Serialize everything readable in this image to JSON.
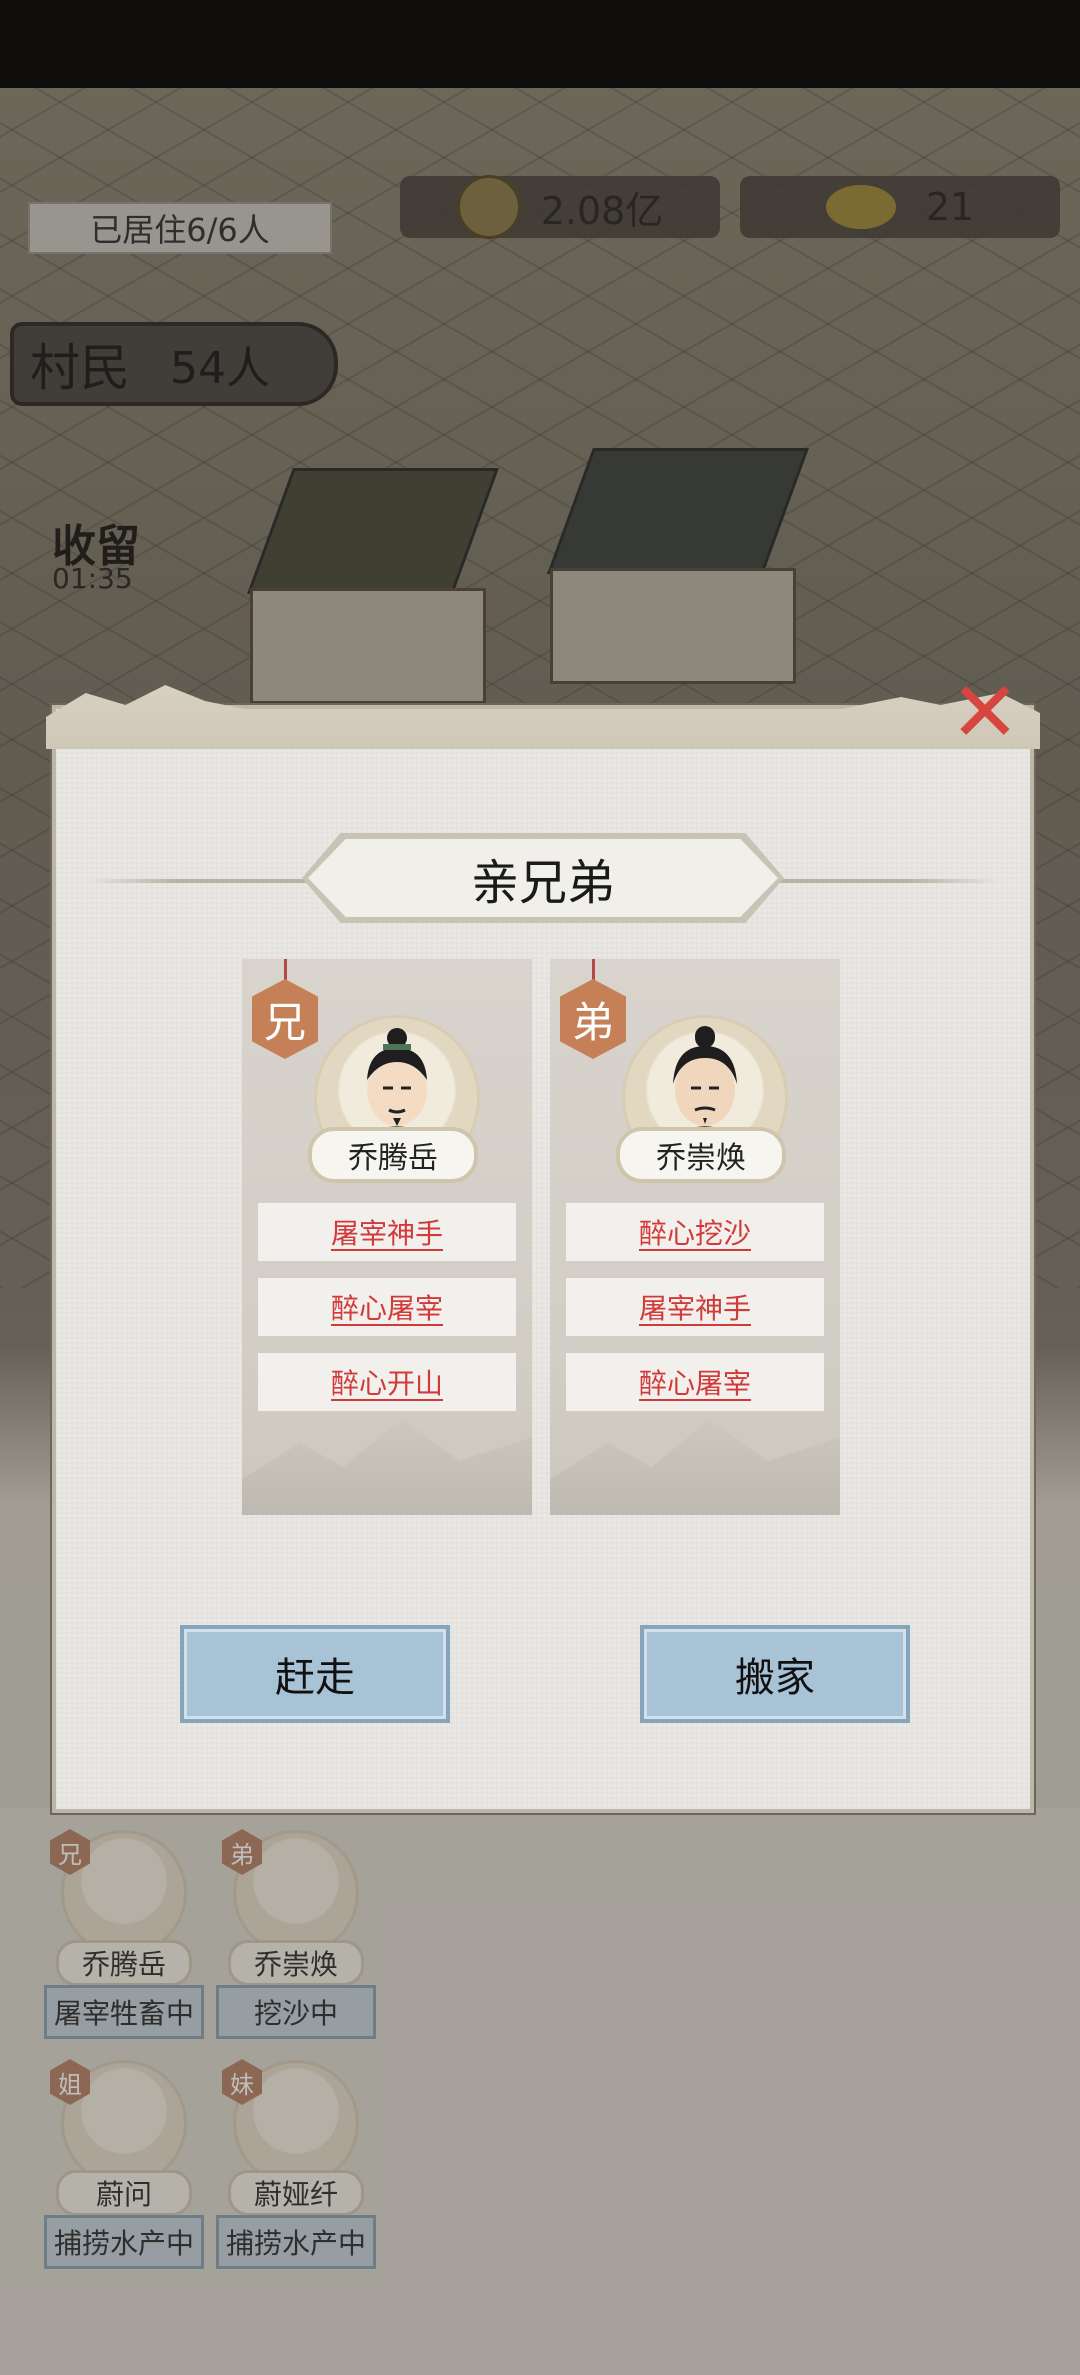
{
  "hud": {
    "residents": "已居住6/6人",
    "copper": "2.08亿",
    "gold": "21",
    "villager_label": "村民",
    "villager_count": "54人",
    "stay_label": "收留",
    "stay_timer": "01:35"
  },
  "background_members": [
    {
      "badge": "兄",
      "name": "乔腾岳",
      "status": "屠宰牲畜中"
    },
    {
      "badge": "弟",
      "name": "乔崇焕",
      "status": "挖沙中"
    },
    {
      "badge": "姐",
      "name": "蔚问",
      "status": "捕捞水产中"
    },
    {
      "badge": "妹",
      "name": "蔚娅纤",
      "status": "捕捞水产中"
    }
  ],
  "dialog": {
    "title": "亲兄弟",
    "close_icon": "close-x-icon",
    "cards": [
      {
        "tag": "兄",
        "name": "乔腾岳",
        "skills": [
          "屠宰神手",
          "醉心屠宰",
          "醉心开山"
        ]
      },
      {
        "tag": "弟",
        "name": "乔崇焕",
        "skills": [
          "醉心挖沙",
          "屠宰神手",
          "醉心屠宰"
        ]
      }
    ],
    "buttons": {
      "evict": "赶走",
      "move": "搬家"
    }
  },
  "colors": {
    "skill_text": "#d23a3a",
    "button_bg": "#a8c3d6",
    "tag_bg": "#c58058",
    "close": "#d6463f"
  }
}
